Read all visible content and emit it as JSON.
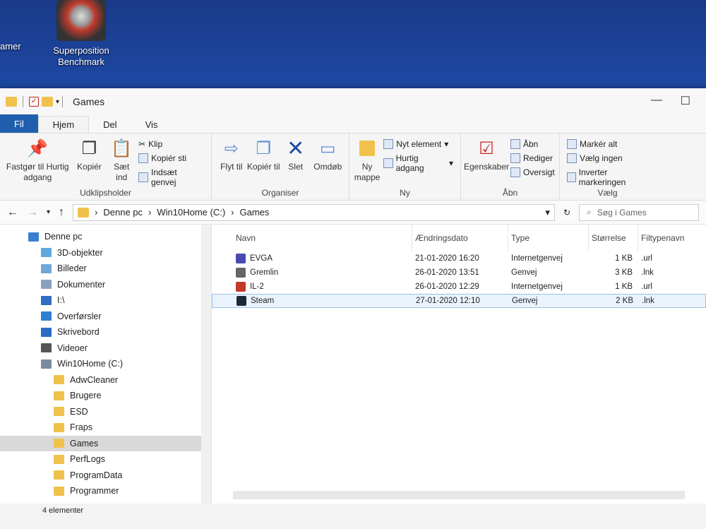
{
  "desktop": {
    "icons": [
      {
        "label": "Superposition Benchmark"
      },
      {
        "label": "amer"
      }
    ]
  },
  "window": {
    "title": "Games"
  },
  "tabs": [
    "Fil",
    "Hjem",
    "Del",
    "Vis"
  ],
  "ribbon": {
    "clipboard": {
      "pin": "Fastgør til Hurtig adgang",
      "copy": "Kopiér",
      "paste": "Sæt ind",
      "cut": "Klip",
      "copy_path": "Kopiér sti",
      "paste_shortcut": "Indsæt genvej",
      "label": "Udklipsholder"
    },
    "organize": {
      "move": "Flyt til",
      "copyto": "Kopiér til",
      "delete": "Slet",
      "rename": "Omdøb",
      "label": "Organiser"
    },
    "new": {
      "new_folder": "Ny mappe",
      "new_item": "Nyt element",
      "easy_access": "Hurtig adgang",
      "label": "Ny"
    },
    "open": {
      "properties": "Egenskaber",
      "open": "Åbn",
      "edit": "Rediger",
      "history": "Oversigt",
      "label": "Åbn"
    },
    "select": {
      "all": "Markér alt",
      "none": "Vælg ingen",
      "invert": "Inverter markeringen",
      "label": "Vælg"
    }
  },
  "address": {
    "crumbs": [
      "Denne pc",
      "Win10Home (C:)",
      "Games"
    ],
    "search_placeholder": "Søg i Games"
  },
  "nav": [
    {
      "label": "Denne pc",
      "indent": 0,
      "color": "#3b7fd0"
    },
    {
      "label": "3D-objekter",
      "indent": 1,
      "color": "#5fa9e0"
    },
    {
      "label": "Billeder",
      "indent": 1,
      "color": "#6fa8d8"
    },
    {
      "label": "Dokumenter",
      "indent": 1,
      "color": "#8aa0c0"
    },
    {
      "label": "I:\\",
      "indent": 1,
      "color": "#2f6fc2"
    },
    {
      "label": "Overførsler",
      "indent": 1,
      "color": "#2f7fd0"
    },
    {
      "label": "Skrivebord",
      "indent": 1,
      "color": "#2b6cc4"
    },
    {
      "label": "Videoer",
      "indent": 1,
      "color": "#555"
    },
    {
      "label": "Win10Home (C:)",
      "indent": 1,
      "color": "#7a8aa0"
    },
    {
      "label": "AdwCleaner",
      "indent": 2,
      "color": "#f0c24c"
    },
    {
      "label": "Brugere",
      "indent": 2,
      "color": "#f0c24c"
    },
    {
      "label": "ESD",
      "indent": 2,
      "color": "#f0c24c"
    },
    {
      "label": "Fraps",
      "indent": 2,
      "color": "#f0c24c"
    },
    {
      "label": "Games",
      "indent": 2,
      "color": "#f0c24c",
      "selected": true
    },
    {
      "label": "PerfLogs",
      "indent": 2,
      "color": "#f0c24c"
    },
    {
      "label": "ProgramData",
      "indent": 2,
      "color": "#f0c24c"
    },
    {
      "label": "Programmer",
      "indent": 2,
      "color": "#f0c24c"
    }
  ],
  "columns": [
    "Navn",
    "Ændringsdato",
    "Type",
    "Størrelse",
    "Filtypenavn"
  ],
  "files": [
    {
      "name": "EVGA",
      "date": "21-01-2020 16:20",
      "type": "Internetgenvej",
      "size": "1 KB",
      "ext": ".url",
      "color": "#4a4ab0"
    },
    {
      "name": "Gremlin",
      "date": "26-01-2020 13:51",
      "type": "Genvej",
      "size": "3 KB",
      "ext": ".lnk",
      "color": "#666"
    },
    {
      "name": "IL-2",
      "date": "26-01-2020 12:29",
      "type": "Internetgenvej",
      "size": "1 KB",
      "ext": ".url",
      "color": "#c0392b"
    },
    {
      "name": "Steam",
      "date": "27-01-2020 12:10",
      "type": "Genvej",
      "size": "2 KB",
      "ext": ".lnk",
      "color": "#1b2838",
      "selected": true
    }
  ],
  "status": "4 elementer"
}
